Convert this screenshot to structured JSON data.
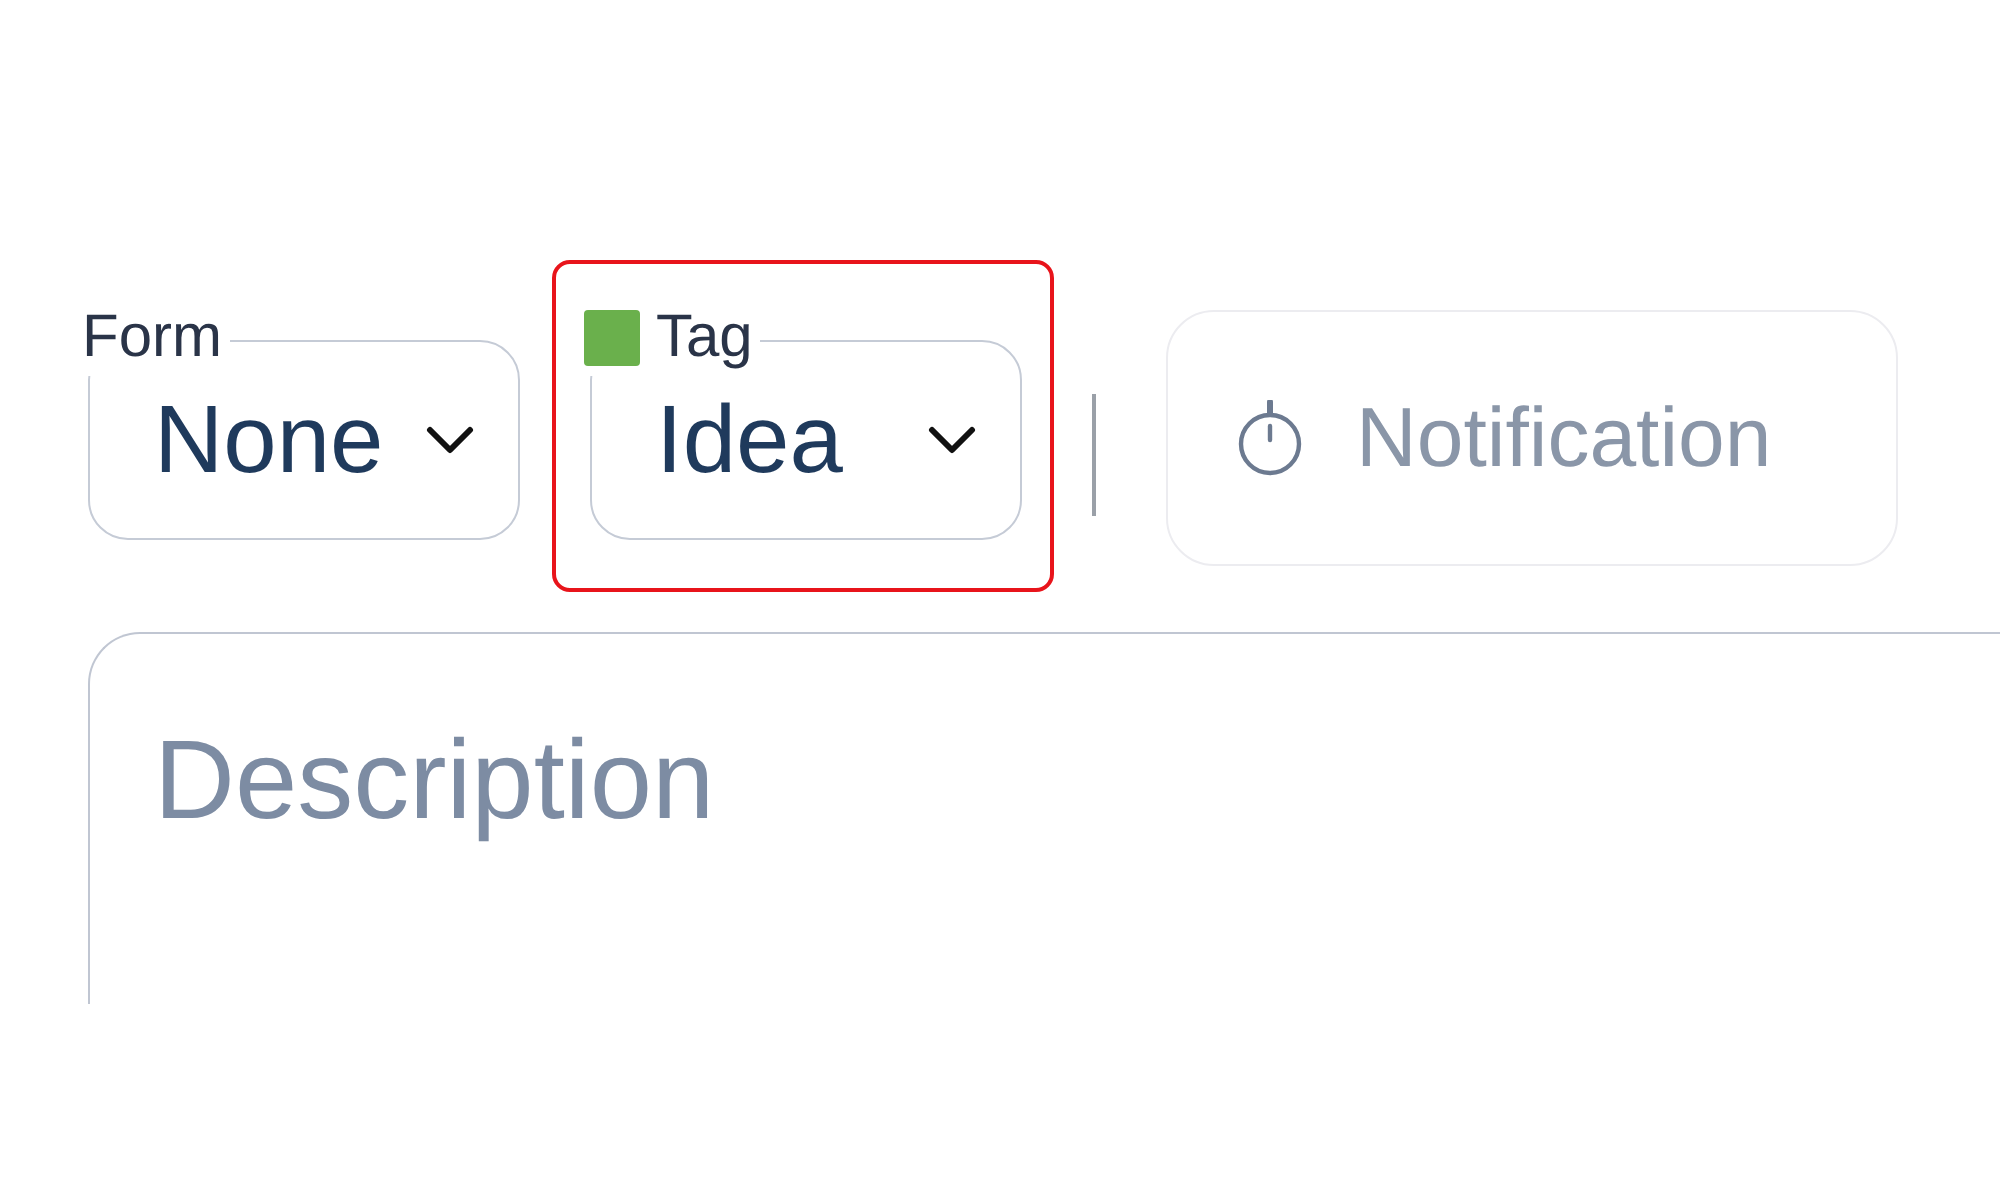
{
  "fields": [
    {
      "kind": "select",
      "label": "Form",
      "value": "None",
      "highlighted": false
    },
    {
      "kind": "select",
      "label": "Tag",
      "value": "Idea",
      "color": "#6ab04c",
      "highlighted": true
    }
  ],
  "notification_button": {
    "label": "Notification"
  },
  "description": {
    "placeholder": "Description"
  }
}
